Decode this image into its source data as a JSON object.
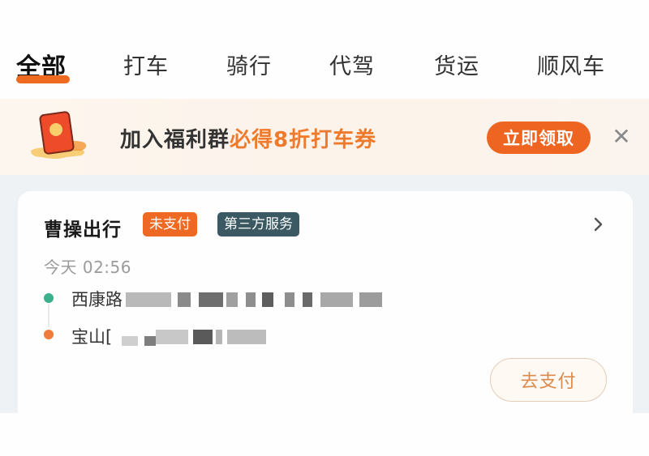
{
  "tabs": [
    {
      "label": "全部",
      "active": true
    },
    {
      "label": "打车",
      "active": false
    },
    {
      "label": "骑行",
      "active": false
    },
    {
      "label": "代驾",
      "active": false
    },
    {
      "label": "货运",
      "active": false
    },
    {
      "label": "顺风车",
      "active": false
    }
  ],
  "banner": {
    "icon": "red-envelope-icon",
    "text_plain": "加入福利群",
    "text_highlight": "必得8折打车券",
    "claim_button": "立即领取",
    "close_icon": "✕"
  },
  "order": {
    "provider": "曹操出行",
    "badges": {
      "status": "未支付",
      "service": "第三方服务"
    },
    "chevron": "›",
    "time": "今天 02:56",
    "start_address": "西康路",
    "end_address": "宝山[",
    "pay_button": "去支付"
  },
  "colors": {
    "accent": "#ee6a20",
    "highlight_text": "#f07a2c",
    "service_badge": "#3a5963",
    "start_dot": "#3cb08c",
    "end_dot": "#ee7a3c"
  }
}
